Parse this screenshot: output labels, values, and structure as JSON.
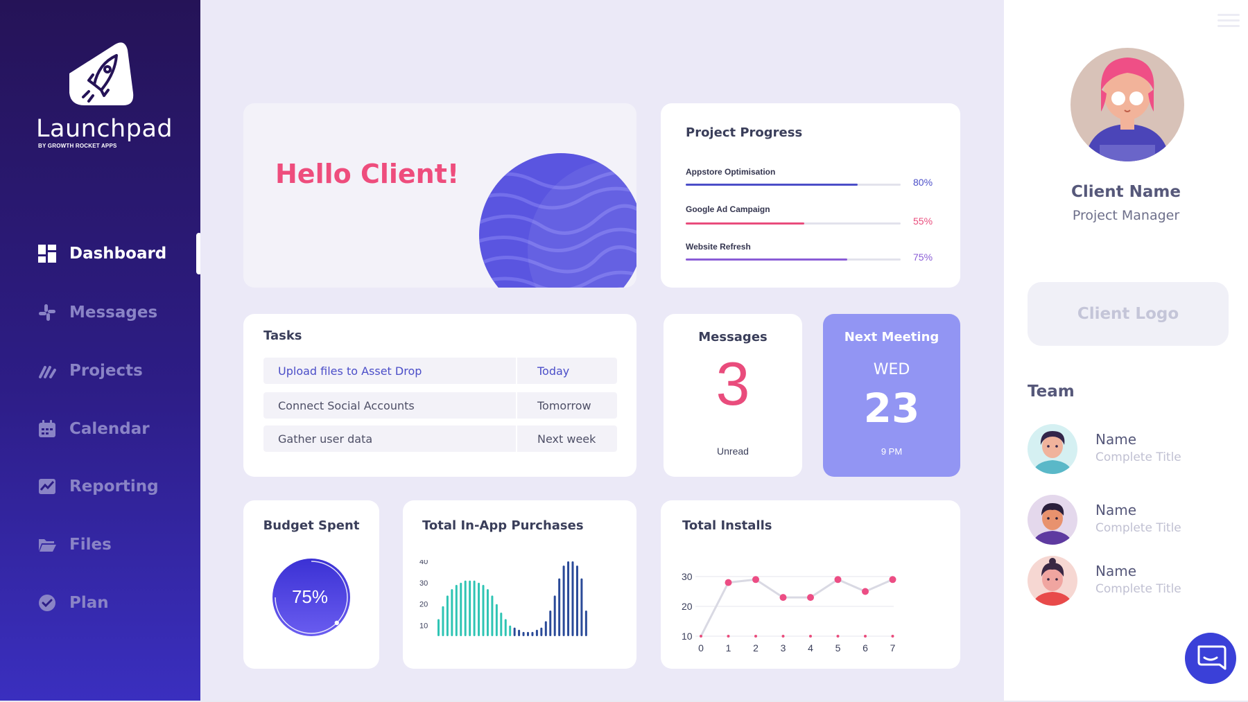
{
  "brand": {
    "name": "Launchpad",
    "subtitle": "BY GROWTH ROCKET APPS"
  },
  "nav": {
    "items": [
      {
        "label": "Dashboard",
        "icon": "dashboard-icon",
        "active": true
      },
      {
        "label": "Messages",
        "icon": "slack-icon"
      },
      {
        "label": "Projects",
        "icon": "projects-icon"
      },
      {
        "label": "Calendar",
        "icon": "calendar-icon"
      },
      {
        "label": "Reporting",
        "icon": "chart-icon"
      },
      {
        "label": "Files",
        "icon": "folder-icon"
      },
      {
        "label": "Plan",
        "icon": "check-circle-icon"
      }
    ]
  },
  "hello": {
    "greeting": "Hello Client!"
  },
  "progress": {
    "title": "Project Progress",
    "items": [
      {
        "label": "Appstore Optimisation",
        "value": "80%",
        "fraction": 0.8,
        "color": "#4b4ec8"
      },
      {
        "label": "Google Ad Campaign",
        "value": "55%",
        "fraction": 0.55,
        "color": "#e94c7c"
      },
      {
        "label": "Website Refresh",
        "value": "75%",
        "fraction": 0.75,
        "color": "#8a5cd6"
      }
    ]
  },
  "tasks": {
    "title": "Tasks",
    "rows": [
      {
        "name": "Upload files to Asset Drop",
        "due": "Today"
      },
      {
        "name": "Connect Social Accounts",
        "due": "Tomorrow"
      },
      {
        "name": "Gather user data",
        "due": "Next week"
      }
    ]
  },
  "messages": {
    "title": "Messages",
    "count": "3",
    "status": "Unread"
  },
  "meeting": {
    "title": "Next Meeting",
    "day": "WED",
    "date": "23",
    "time": "9 PM"
  },
  "budget": {
    "title": "Budget Spent",
    "value": "75%",
    "fraction": 0.75
  },
  "charts": {
    "purchases": {
      "title": "Total In-App Purchases",
      "chart_data": {
        "type": "bar",
        "yticks": [
          "40",
          "30",
          "20",
          "10"
        ],
        "ylim": [
          5,
          40
        ],
        "values": [
          13,
          19,
          24,
          27,
          29,
          30,
          31,
          31,
          31,
          30,
          29,
          27,
          24,
          20,
          16,
          13,
          10,
          9,
          8,
          7,
          7,
          7,
          8,
          9,
          12,
          17,
          24,
          32,
          38,
          40,
          40,
          38,
          32,
          17
        ],
        "colors": [
          "#2fc4b4",
          "#2a4a98"
        ]
      }
    },
    "installs": {
      "title": "Total Installs",
      "chart_data": {
        "type": "line",
        "x": [
          0,
          1,
          2,
          3,
          4,
          5,
          6,
          7
        ],
        "y": [
          10,
          28,
          29,
          23,
          23,
          29,
          25,
          29
        ],
        "yticks": [
          30,
          20,
          10
        ],
        "baseline": [
          10,
          10,
          10,
          10,
          10,
          10,
          10,
          10
        ],
        "ylim": [
          10,
          30
        ]
      }
    }
  },
  "client": {
    "name": "Client Name",
    "role": "Project Manager",
    "logo_placeholder": "Client Logo"
  },
  "team": {
    "title": "Team",
    "members": [
      {
        "name": "Name",
        "title": "Complete Title"
      },
      {
        "name": "Name",
        "title": "Complete Title"
      },
      {
        "name": "Name",
        "title": "Complete Title"
      }
    ]
  }
}
